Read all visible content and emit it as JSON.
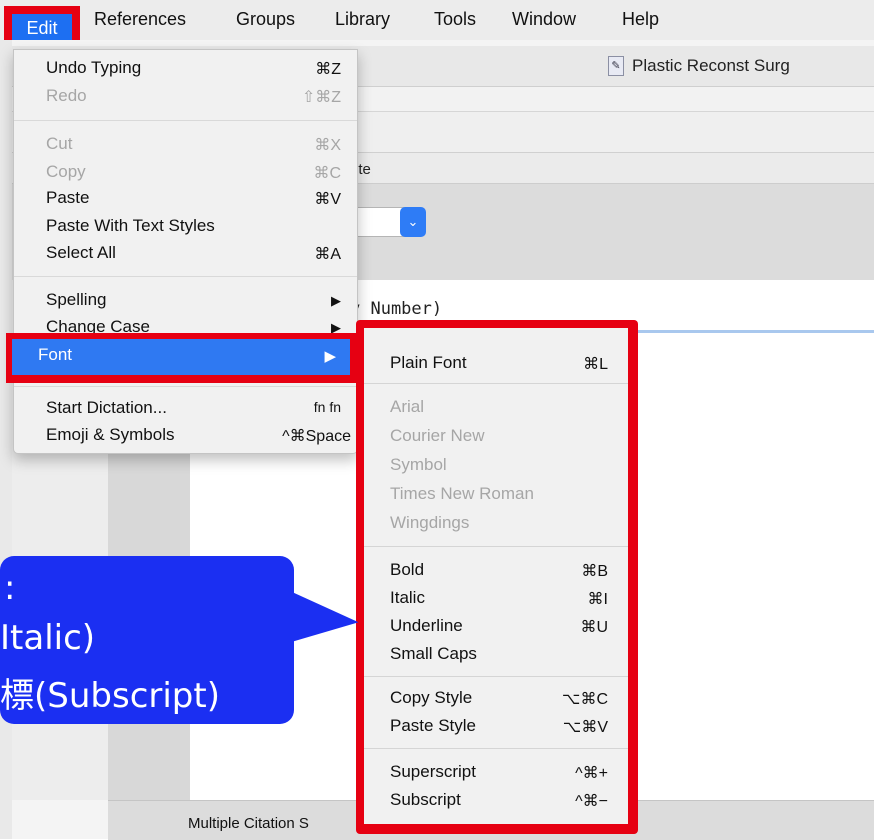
{
  "menubar": {
    "items": [
      "Edit",
      "References",
      "Groups",
      "Library",
      "Tools",
      "Window",
      "Help"
    ]
  },
  "window": {
    "title": "Plastic Reconst Surg",
    "tab_fragment": "ite",
    "code_text": "y Number)",
    "bottom_label": "Multiple Citation S"
  },
  "edit_menu": {
    "items": [
      {
        "label": "Undo Typing",
        "shortcut": "⌘Z",
        "enabled": true
      },
      {
        "label": "Redo",
        "shortcut": "⇧⌘Z",
        "enabled": false
      },
      {
        "label": "Cut",
        "shortcut": "⌘X",
        "enabled": false
      },
      {
        "label": "Copy",
        "shortcut": "⌘C",
        "enabled": false
      },
      {
        "label": "Paste",
        "shortcut": "⌘V",
        "enabled": true
      },
      {
        "label": "Paste With Text Styles",
        "shortcut": "",
        "enabled": true
      },
      {
        "label": "Select All",
        "shortcut": "⌘A",
        "enabled": true
      },
      {
        "label": "Spelling",
        "shortcut": "▶",
        "enabled": true
      },
      {
        "label": "Change Case",
        "shortcut": "▶",
        "enabled": true
      },
      {
        "label": "Font",
        "shortcut": "▶",
        "enabled": true
      },
      {
        "label": "Start Dictation...",
        "shortcut": "fn fn",
        "enabled": true
      },
      {
        "label": "Emoji & Symbols",
        "shortcut": "^⌘Space",
        "enabled": true
      }
    ]
  },
  "font_menu": {
    "items": [
      {
        "label": "Plain Font",
        "shortcut": "⌘L",
        "enabled": true
      },
      {
        "label": "Arial",
        "shortcut": "",
        "enabled": false
      },
      {
        "label": "Courier New",
        "shortcut": "",
        "enabled": false
      },
      {
        "label": "Symbol",
        "shortcut": "",
        "enabled": false
      },
      {
        "label": "Times New Roman",
        "shortcut": "",
        "enabled": false
      },
      {
        "label": "Wingdings",
        "shortcut": "",
        "enabled": false
      },
      {
        "label": "Bold",
        "shortcut": "⌘B",
        "enabled": true
      },
      {
        "label": "Italic",
        "shortcut": "⌘I",
        "enabled": true
      },
      {
        "label": "Underline",
        "shortcut": "⌘U",
        "enabled": true
      },
      {
        "label": "Small Caps",
        "shortcut": "",
        "enabled": true
      },
      {
        "label": "Copy Style",
        "shortcut": "⌥⌘C",
        "enabled": true
      },
      {
        "label": "Paste Style",
        "shortcut": "⌥⌘V",
        "enabled": true
      },
      {
        "label": "Superscript",
        "shortcut": "^⌘+",
        "enabled": true
      },
      {
        "label": "Subscript",
        "shortcut": "^⌘−",
        "enabled": true
      }
    ]
  },
  "callout": {
    "lines": [
      ":",
      "Italic)",
      "標(Subscript)"
    ]
  },
  "colors": {
    "highlight_red": "#e60012",
    "selection_blue": "#2f79f2",
    "callout_blue": "#1b2ff2"
  }
}
